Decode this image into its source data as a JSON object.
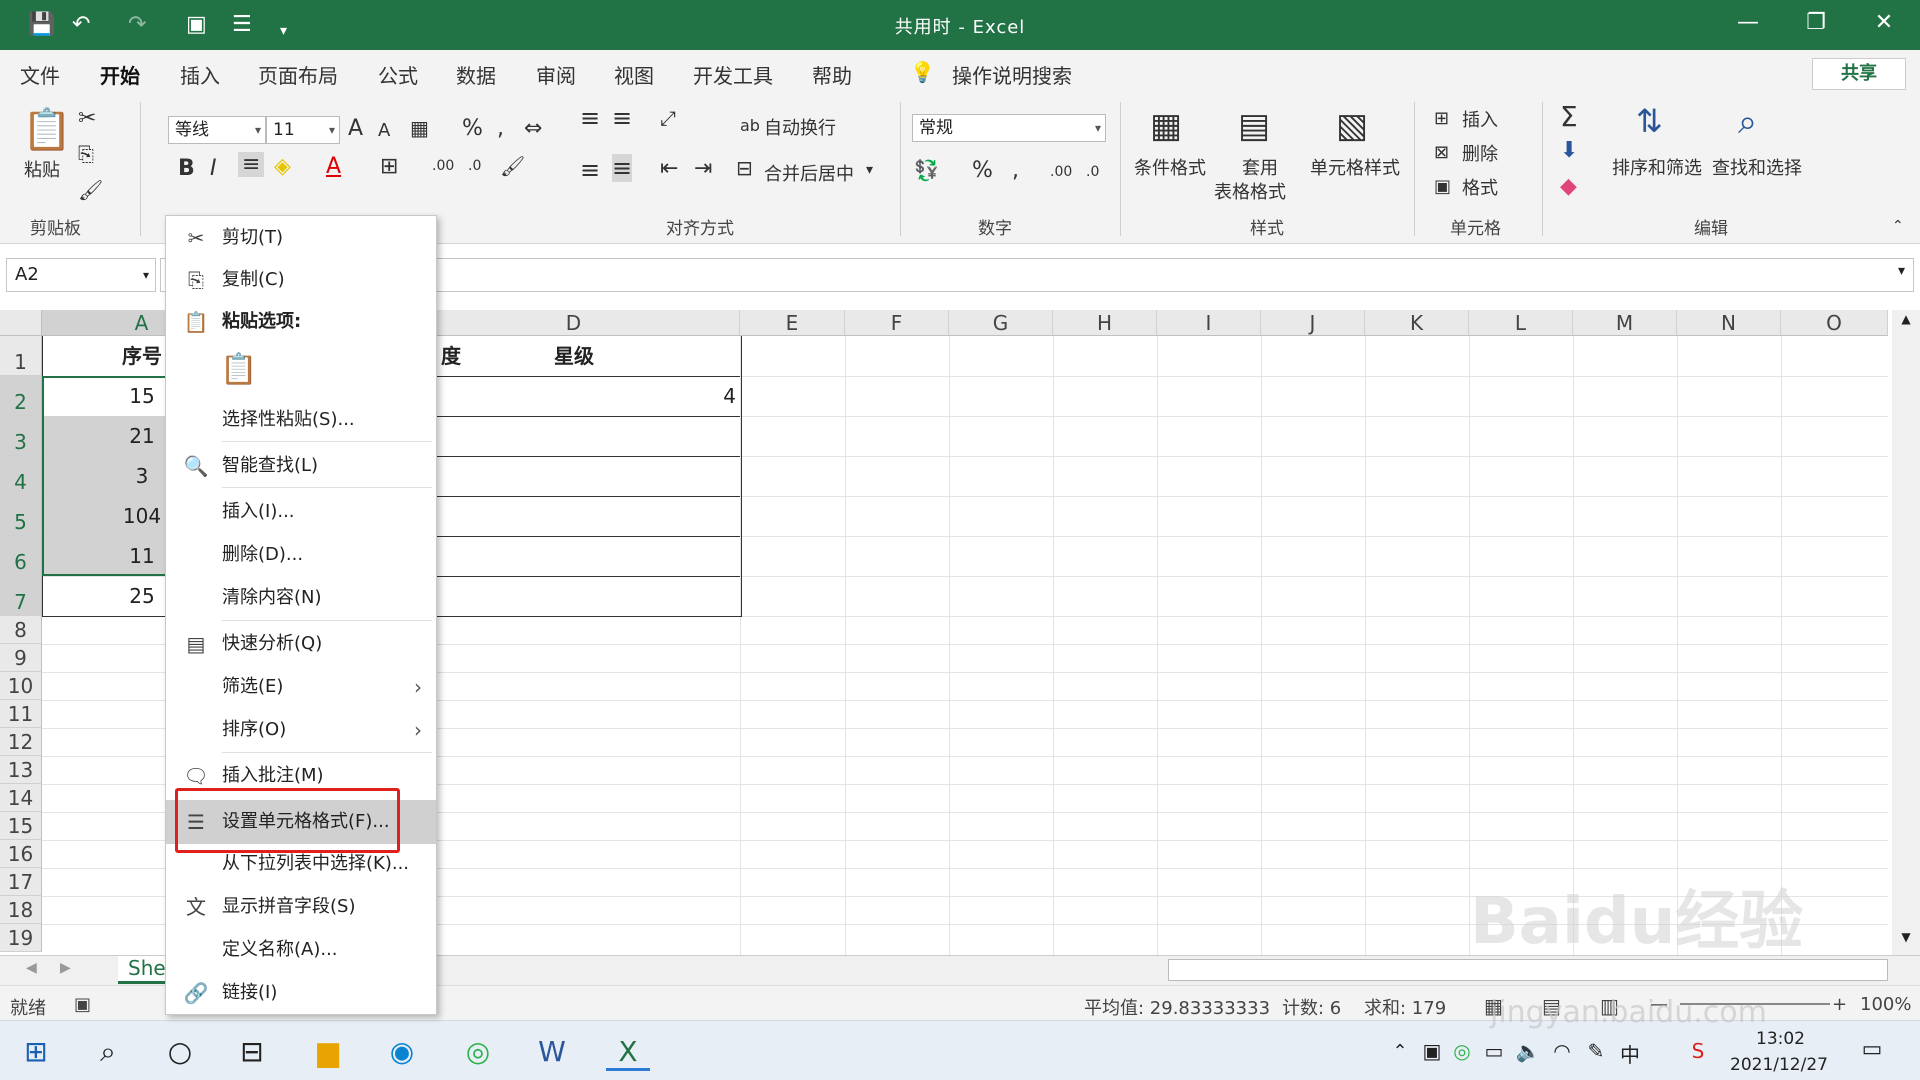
{
  "titlebar": {
    "title": "共用时 - Excel",
    "save_icon": "💾",
    "undo_icon": "↶",
    "redo_icon": "↷",
    "window_min": "—",
    "window_restore": "❐",
    "window_close": "✕"
  },
  "tabs": [
    "文件",
    "开始",
    "插入",
    "页面布局",
    "公式",
    "数据",
    "审阅",
    "视图",
    "开发工具",
    "帮助"
  ],
  "active_tab": "开始",
  "tell_me": "操作说明搜索",
  "share": "共享",
  "ribbon": {
    "clipboard": {
      "paste": "粘贴",
      "group": "剪贴板"
    },
    "font": {
      "name": "等线",
      "size": "11",
      "bold": "B",
      "italic": "I",
      "font_color_a": "A"
    },
    "align": {
      "wrap": "自动换行",
      "merge": "合并后居中",
      "group": "对齐方式"
    },
    "number": {
      "format": "常规",
      "percent": "%",
      "comma": ",",
      "group": "数字"
    },
    "styles": {
      "cond": "条件格式",
      "table1": "套用",
      "table2": "表格格式",
      "cell": "单元格样式",
      "group": "样式"
    },
    "cells": {
      "insert": "插入",
      "delete": "删除",
      "format": "格式",
      "group": "单元格"
    },
    "editing": {
      "sum": "Σ",
      "sort": "排序和筛选",
      "find": "查找和选择",
      "group": "编辑"
    }
  },
  "namebox": "A2",
  "columns": [
    "A",
    "B",
    "C",
    "D",
    "E",
    "F",
    "G",
    "H",
    "I",
    "J",
    "K",
    "L",
    "M",
    "N",
    "O"
  ],
  "rows": [
    "1",
    "2",
    "3",
    "4",
    "5",
    "6",
    "7",
    "8",
    "9",
    "10",
    "11",
    "12",
    "13",
    "14",
    "15",
    "16",
    "17",
    "18",
    "19"
  ],
  "cells": {
    "A1": "序号",
    "A2": "15",
    "A3": "21",
    "A4": "3",
    "A5": "104",
    "A6": "11",
    "A7": "25",
    "C1_partial": "度",
    "D1": "星级",
    "D2": "4"
  },
  "context_menu": [
    {
      "id": "cut",
      "label": "剪切(T)",
      "icon": "✂"
    },
    {
      "id": "copy",
      "label": "复制(C)",
      "icon": "⎘"
    },
    {
      "id": "paste-options",
      "label": "粘贴选项:",
      "icon": "📋"
    },
    {
      "id": "paste-special",
      "label": "选择性粘贴(S)..."
    },
    {
      "id": "smart-lookup",
      "label": "智能查找(L)",
      "icon": "🔍"
    },
    {
      "id": "insert",
      "label": "插入(I)..."
    },
    {
      "id": "delete",
      "label": "删除(D)..."
    },
    {
      "id": "clear",
      "label": "清除内容(N)"
    },
    {
      "id": "quick-analysis",
      "label": "快速分析(Q)",
      "icon": "▤"
    },
    {
      "id": "filter",
      "label": "筛选(E)",
      "arrow": "›"
    },
    {
      "id": "sort",
      "label": "排序(O)",
      "arrow": "›"
    },
    {
      "id": "insert-comment",
      "label": "插入批注(M)",
      "icon": "🗨"
    },
    {
      "id": "format-cells",
      "label": "设置单元格格式(F)...",
      "icon": "☰"
    },
    {
      "id": "pick-list",
      "label": "从下拉列表中选择(K)..."
    },
    {
      "id": "phonetic",
      "label": "显示拼音字段(S)",
      "icon": "文"
    },
    {
      "id": "define-name",
      "label": "定义名称(A)..."
    },
    {
      "id": "link",
      "label": "链接(I)",
      "icon": "🔗"
    }
  ],
  "sheet_tab": "She",
  "status": {
    "ready": "就绪",
    "average": "平均值: 29.83333333",
    "count": "计数: 6",
    "sum": "求和: 179",
    "zoom": "100%"
  },
  "taskbar": {
    "time": "13:02",
    "date": "2021/12/27",
    "ime": "中"
  },
  "watermark": {
    "text": "Baidu经验",
    "url": "jingyan.baidu.com"
  },
  "accent": "#217346",
  "highlight": "#e0201c"
}
